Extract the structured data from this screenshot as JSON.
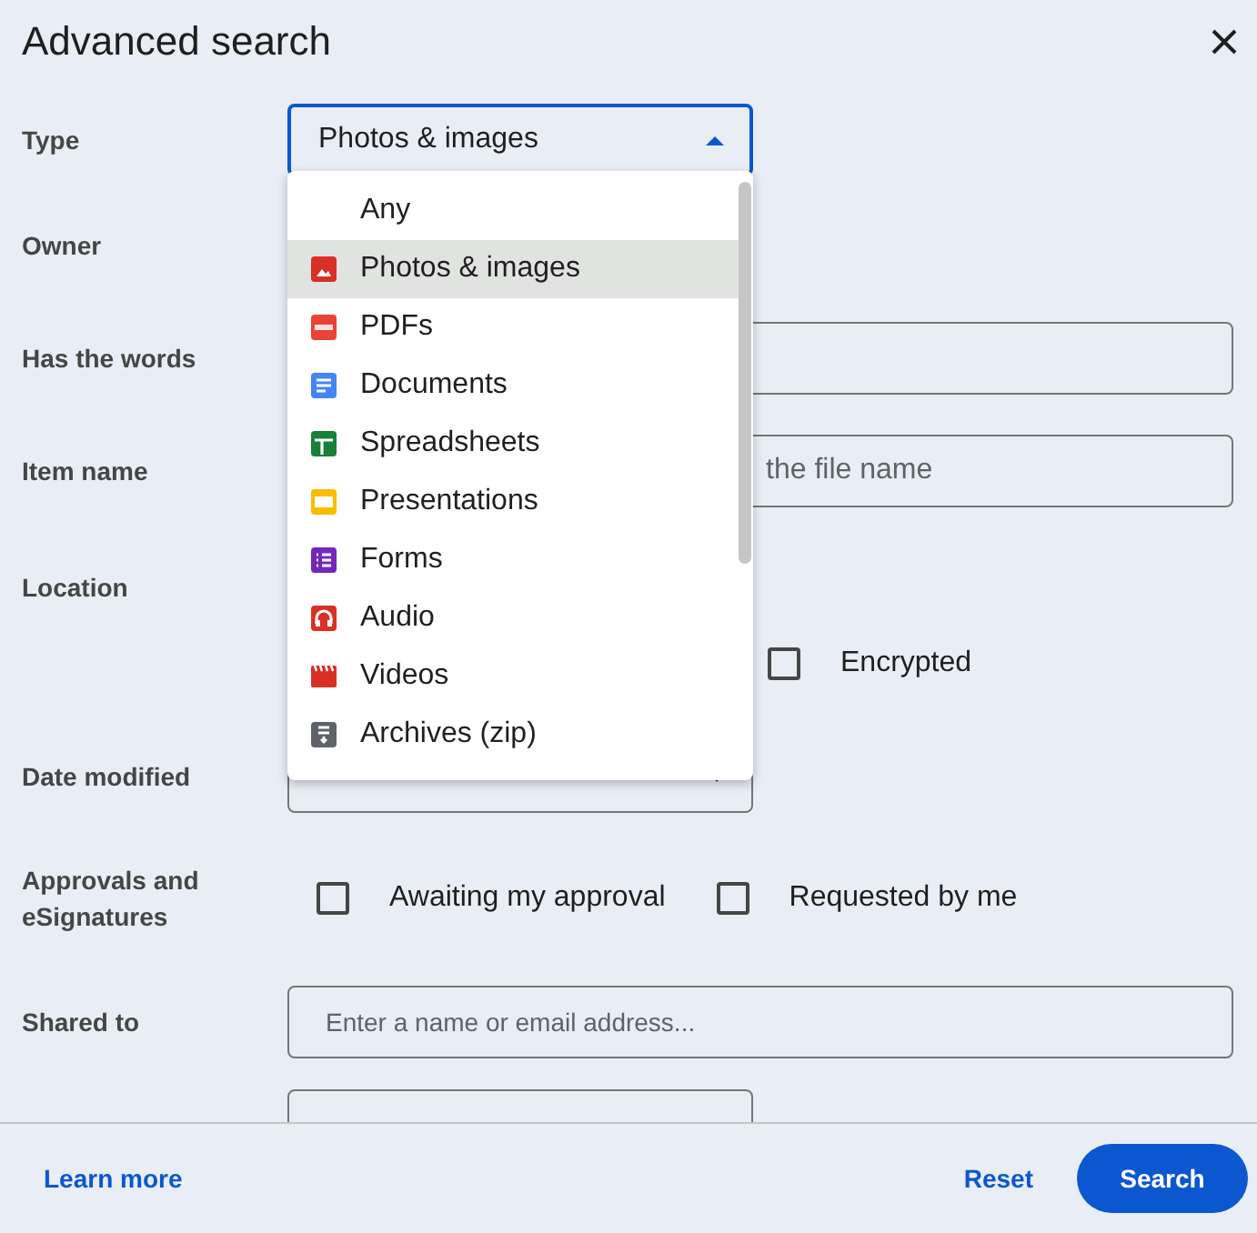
{
  "dialog": {
    "title": "Advanced search"
  },
  "fields": [
    {
      "label": "Type",
      "kind": "select",
      "value": "Photos & images",
      "expanded": true
    },
    {
      "label": "Owner",
      "kind": "hidden"
    },
    {
      "label": "Has the words",
      "kind": "text"
    },
    {
      "label": "Item name",
      "kind": "text",
      "placeholder": "the file name"
    },
    {
      "label": "Location",
      "kind": "checks",
      "checks": [
        {
          "label": "Encrypted",
          "checked": false
        }
      ]
    },
    {
      "label": "Date modified",
      "kind": "select"
    },
    {
      "label": "Approvals and eSignatures",
      "kind": "checks",
      "checks": [
        {
          "label": "Awaiting my approval",
          "checked": false
        },
        {
          "label": "Requested by me",
          "checked": false
        }
      ]
    },
    {
      "label": "Shared to",
      "kind": "text",
      "wide": true,
      "placeholder": "Enter a name or email address..."
    },
    {
      "kind": "select"
    }
  ],
  "type_menu": [
    {
      "label": "Any",
      "kind": "none",
      "selected": false
    },
    {
      "label": "Photos & images",
      "kind": "image",
      "selected": true
    },
    {
      "label": "PDFs",
      "kind": "pdf",
      "selected": false
    },
    {
      "label": "Documents",
      "kind": "doc",
      "selected": false
    },
    {
      "label": "Spreadsheets",
      "kind": "sheet",
      "selected": false
    },
    {
      "label": "Presentations",
      "kind": "slides",
      "selected": false
    },
    {
      "label": "Forms",
      "kind": "form",
      "selected": false
    },
    {
      "label": "Audio",
      "kind": "audio",
      "selected": false
    },
    {
      "label": "Videos",
      "kind": "video",
      "selected": false
    },
    {
      "label": "Archives (zip)",
      "kind": "archive",
      "selected": false
    }
  ],
  "footer": {
    "link": "Learn more",
    "buttons": [
      "Reset",
      "Search"
    ]
  }
}
